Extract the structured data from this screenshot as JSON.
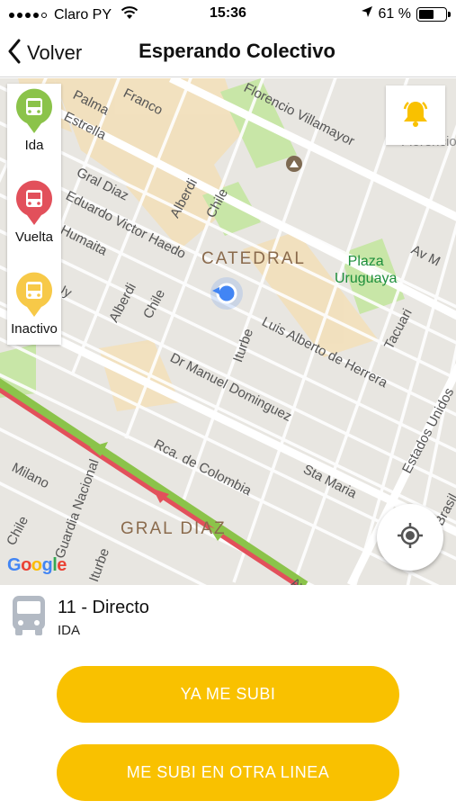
{
  "status_bar": {
    "carrier": "Claro PY",
    "time": "15:36",
    "battery_percent": "61 %",
    "battery_level": 0.61
  },
  "nav": {
    "back_label": "Volver",
    "title": "Esperando Colectivo"
  },
  "map": {
    "labels": {
      "palma": "Palma",
      "estrella": "Estrella",
      "gral_diaz_street": "Gral Diaz",
      "eduardo_victor_haedo": "Eduardo Victor Haedo",
      "humaita": "Humaita",
      "uy": "Uy",
      "alberdi_top": "Alberdi",
      "chile_top": "Chile",
      "alberdi_mid": "Alberdi",
      "chile_mid": "Chile",
      "franco": "Franco",
      "florencio_villamayor": "Florencio Villamayor",
      "florencio": "Florencio",
      "catedral": "CATEDRAL",
      "plaza_uruguaya": "Plaza\nUruguaya",
      "av_m": "Av M",
      "tacuari": "Tacuari",
      "luis_alberto_de_herrera": "Luis Alberto de Herrera",
      "iturbe": "Iturbe",
      "dr_manuel_dominguez": "Dr Manuel Dominguez",
      "estados_unidos": "Estados Unidos",
      "rca_de_colombia": "Rca. de Colombia",
      "sta_maria": "Sta Maria",
      "milano": "Milano",
      "chile_low": "Chile",
      "guardia_nacional": "Guardia Nacional",
      "iturbe_low": "Iturbe",
      "brasil": "Brasil",
      "gral_diaz_area": "GRAL DIAZ",
      "av": "Av"
    },
    "legend": {
      "ida": {
        "label": "Ida",
        "color": "#8bc34a"
      },
      "vuelta": {
        "label": "Vuelta",
        "color": "#e2505b"
      },
      "inactivo": {
        "label": "Inactivo",
        "color": "#f7c948"
      }
    },
    "colors": {
      "route_red": "#e2505b",
      "route_green": "#8bc34a",
      "location_dot": "#4285f4",
      "bell": "#f9c100"
    }
  },
  "route": {
    "name": "11 - Directo",
    "direction": "IDA"
  },
  "buttons": {
    "primary": "YA ME SUBI",
    "secondary": "ME SUBI EN OTRA LINEA"
  },
  "icons": {
    "back": "chevron-left-icon",
    "bell": "bell-icon",
    "locate": "crosshair-icon",
    "bus": "bus-icon",
    "wifi": "wifi-icon",
    "location_arrow": "location-arrow-icon"
  }
}
